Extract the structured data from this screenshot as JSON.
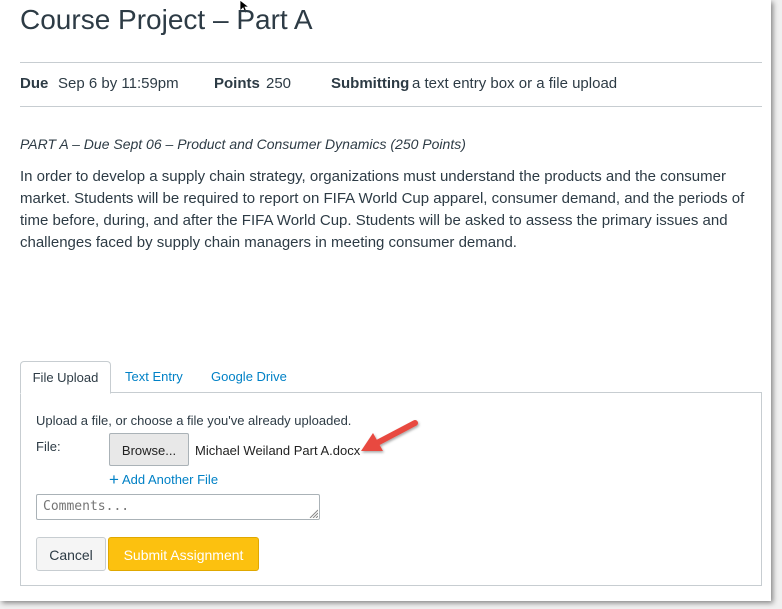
{
  "assignment": {
    "title": "Course Project – Part A",
    "due_label": "Due",
    "due_value": "Sep 6 by 11:59pm",
    "points_label": "Points",
    "points_value": "250",
    "submitting_label": "Submitting",
    "submitting_value": "a text entry box or a file upload",
    "subtitle": "PART A – Due Sept 06 – Product and Consumer Dynamics (250 Points)",
    "description": "In order to develop a supply chain strategy, organizations must understand the products and the consumer market. Students will be required to report on FIFA World Cup apparel, consumer demand, and the periods of time before, during, and after the FIFA World Cup.  Students will be asked to assess the primary issues and challenges faced by supply chain managers in meeting consumer demand."
  },
  "tabs": [
    {
      "label": "File Upload",
      "active": true
    },
    {
      "label": "Text Entry",
      "active": false
    },
    {
      "label": "Google Drive",
      "active": false
    }
  ],
  "upload": {
    "hint": "Upload a file, or choose a file you've already uploaded.",
    "file_label": "File:",
    "browse_label": "Browse...",
    "file_name": "Michael Weiland Part A.docx",
    "add_file_label": "Add Another File",
    "comments_placeholder": "Comments..."
  },
  "actions": {
    "cancel_label": "Cancel",
    "submit_label": "Submit Assignment"
  },
  "colors": {
    "link": "#0081c6",
    "submit": "#fcc10f",
    "annotation_arrow": "#e8493f"
  },
  "icons": {
    "cursor": "mouse-cursor-icon",
    "arrow": "annotation-arrow-icon",
    "plus": "plus-icon",
    "resize": "resize-grip-icon"
  }
}
